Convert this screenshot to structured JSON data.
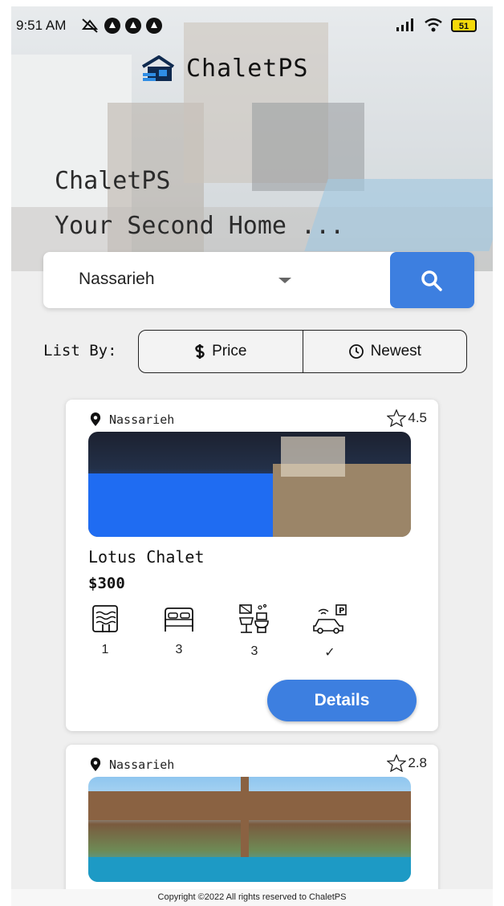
{
  "status_bar": {
    "time": "9:51 AM",
    "battery": "51"
  },
  "brand": {
    "name": "ChaletPS"
  },
  "hero": {
    "line1": "ChaletPS",
    "line2": "Your Second Home ..."
  },
  "search": {
    "selected_location": "Nassarieh"
  },
  "list_by": {
    "label": "List By:",
    "options": [
      "Price",
      "Newest"
    ]
  },
  "listings": [
    {
      "location": "Nassarieh",
      "rating": "4.5",
      "title": "Lotus Chalet",
      "price": "$300",
      "amenities": {
        "pools": "1",
        "bedrooms": "3",
        "bathrooms": "3",
        "parking": "✓"
      },
      "details_label": "Details"
    },
    {
      "location": "Nassarieh",
      "rating": "2.8"
    }
  ],
  "footer": {
    "text": "Copyright ©2022 All rights reserved to ChaletPS"
  },
  "colors": {
    "accent": "#3d7fe0",
    "background": "#efefef"
  }
}
